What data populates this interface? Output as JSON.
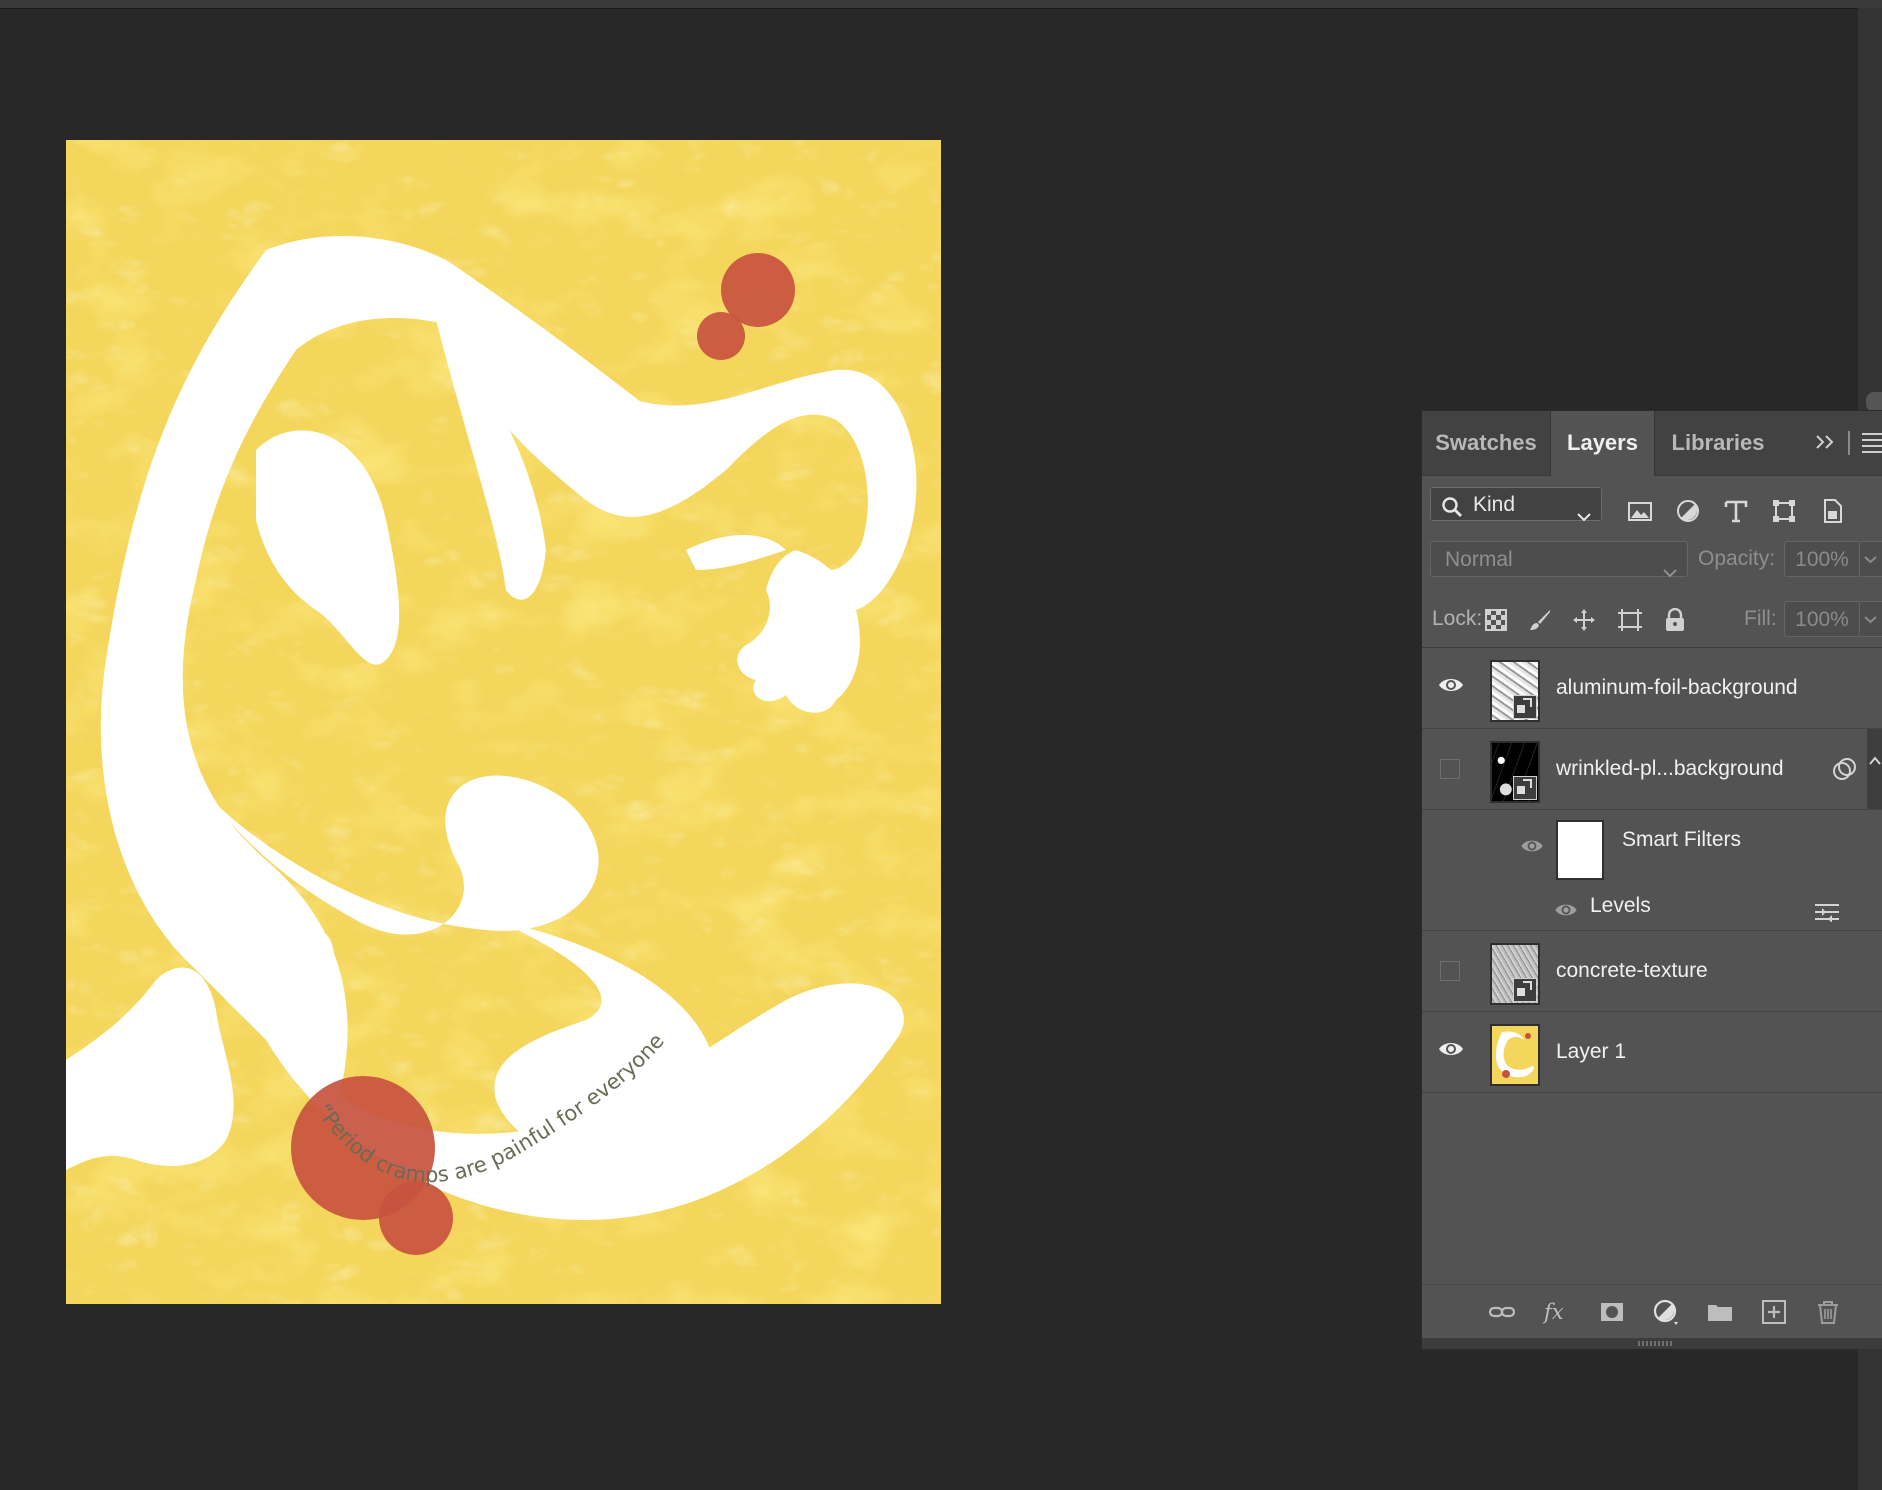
{
  "canvas": {
    "quote": "“Period cramps are painful for everyone.”",
    "colors": {
      "background": "#f4d65c",
      "figure": "#ffffff",
      "accent": "#c8523f"
    }
  },
  "panel": {
    "tabs": [
      {
        "label": "Swatches",
        "active": false
      },
      {
        "label": "Layers",
        "active": true
      },
      {
        "label": "Libraries",
        "active": false
      }
    ],
    "collapse_icon": "double-chevron-right-icon",
    "menu_icon": "panel-menu-icon",
    "filter": {
      "kind_label": "Kind",
      "icons": [
        "pixel-layer-filter-icon",
        "adjustment-layer-filter-icon",
        "type-layer-filter-icon",
        "shape-layer-filter-icon",
        "smart-object-filter-icon"
      ]
    },
    "blend": {
      "mode": "Normal",
      "opacity_label": "Opacity:",
      "opacity_value": "100%"
    },
    "lock": {
      "label": "Lock:",
      "icons": [
        "lock-transparent-pixels-icon",
        "lock-image-pixels-icon",
        "lock-position-icon",
        "lock-artboard-icon",
        "lock-all-icon"
      ],
      "fill_label": "Fill:",
      "fill_value": "100%"
    },
    "layers": [
      {
        "name": "aluminum-foil-background",
        "visible": true,
        "smart": true
      },
      {
        "name": "wrinkled-pl...background",
        "visible": false,
        "smart": true,
        "has_filters": true
      },
      {
        "name": "concrete-texture",
        "visible": false,
        "smart": true
      },
      {
        "name": "Layer 1",
        "visible": true,
        "smart": false
      }
    ],
    "smart_filters": {
      "label": "Smart Filters",
      "filter_name": "Levels"
    },
    "bottom_icons": [
      "link-layers-icon",
      "layer-style-fx-icon",
      "add-mask-icon",
      "new-adjustment-layer-icon",
      "new-group-folder-icon",
      "new-layer-icon",
      "delete-layer-icon"
    ]
  }
}
